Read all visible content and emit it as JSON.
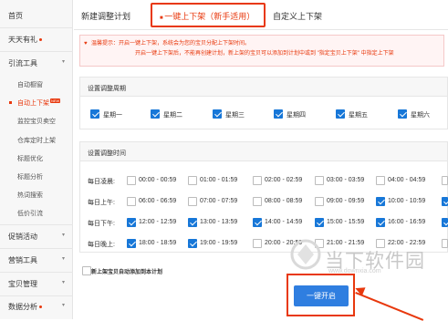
{
  "sidebar": {
    "items": [
      {
        "label": "首页"
      },
      {
        "label": "天天有礼"
      },
      {
        "label": "引流工具"
      },
      {
        "label": "自动橱窗"
      },
      {
        "label": "自动上下架",
        "badge": "NEW"
      },
      {
        "label": "监控宝贝卖空"
      },
      {
        "label": "仓库定时上架"
      },
      {
        "label": "标题优化"
      },
      {
        "label": "标题分析"
      },
      {
        "label": "热词搜索"
      },
      {
        "label": "低价引流"
      },
      {
        "label": "促销活动"
      },
      {
        "label": "营销工具"
      },
      {
        "label": "宝贝管理"
      },
      {
        "label": "数据分析"
      }
    ]
  },
  "tabs": [
    {
      "label": "新建调整计划"
    },
    {
      "label": "一键上下架（新手适用）"
    },
    {
      "label": "自定义上下架"
    }
  ],
  "tip": {
    "line1": "温馨提示：开启一键上下架，系统会为您的宝贝分配上下架时间。",
    "line2": "开启一键上下架后，不能再创建计划，新上架的宝贝可以添加到计划中或到 \"指定宝贝上下架\" 中指定上下架"
  },
  "cycle": {
    "title": "设置调整周期",
    "days": [
      {
        "label": "星期一",
        "checked": true
      },
      {
        "label": "星期二",
        "checked": true
      },
      {
        "label": "星期三",
        "checked": true
      },
      {
        "label": "星期四",
        "checked": true
      },
      {
        "label": "星期五",
        "checked": true
      },
      {
        "label": "星期六",
        "checked": true
      }
    ]
  },
  "time": {
    "title": "设置调整时间",
    "rows": [
      {
        "label": "每日凌晨:",
        "slots": [
          {
            "label": "00:00 - 00:59",
            "checked": false
          },
          {
            "label": "01:00 - 01:59",
            "checked": false
          },
          {
            "label": "02:00 - 02:59",
            "checked": false
          },
          {
            "label": "03:00 - 03:59",
            "checked": false
          },
          {
            "label": "04:00 - 04:59",
            "checked": false
          },
          {
            "label": "",
            "checked": false
          }
        ]
      },
      {
        "label": "每日上午:",
        "slots": [
          {
            "label": "06:00 - 06:59",
            "checked": false
          },
          {
            "label": "07:00 - 07:59",
            "checked": false
          },
          {
            "label": "08:00 - 08:59",
            "checked": false
          },
          {
            "label": "09:00 - 09:59",
            "checked": false
          },
          {
            "label": "10:00 - 10:59",
            "checked": true
          },
          {
            "label": "",
            "checked": true
          }
        ]
      },
      {
        "label": "每日下午:",
        "slots": [
          {
            "label": "12:00 - 12:59",
            "checked": true
          },
          {
            "label": "13:00 - 13:59",
            "checked": true
          },
          {
            "label": "14:00 - 14:59",
            "checked": true
          },
          {
            "label": "15:00 - 15:59",
            "checked": true
          },
          {
            "label": "16:00 - 16:59",
            "checked": true
          },
          {
            "label": "",
            "checked": true
          }
        ]
      },
      {
        "label": "每日晚上:",
        "slots": [
          {
            "label": "18:00 - 18:59",
            "checked": true
          },
          {
            "label": "19:00 - 19:59",
            "checked": true
          },
          {
            "label": "20:00 - 20:59",
            "checked": false
          },
          {
            "label": "21:00 - 21:59",
            "checked": false
          },
          {
            "label": "22:00 - 22:59",
            "checked": false
          },
          {
            "label": "",
            "checked": false
          }
        ]
      }
    ]
  },
  "auto_add": {
    "label": "新上架宝贝自动添加到本计划",
    "checked": false
  },
  "start_button": {
    "label": "一键开启"
  },
  "watermark": {
    "text": "当下软件园",
    "url": "www.downxia.com"
  },
  "colors": {
    "accent": "#e8380d",
    "primary": "#2f7ee0",
    "check": "#1777d8"
  }
}
